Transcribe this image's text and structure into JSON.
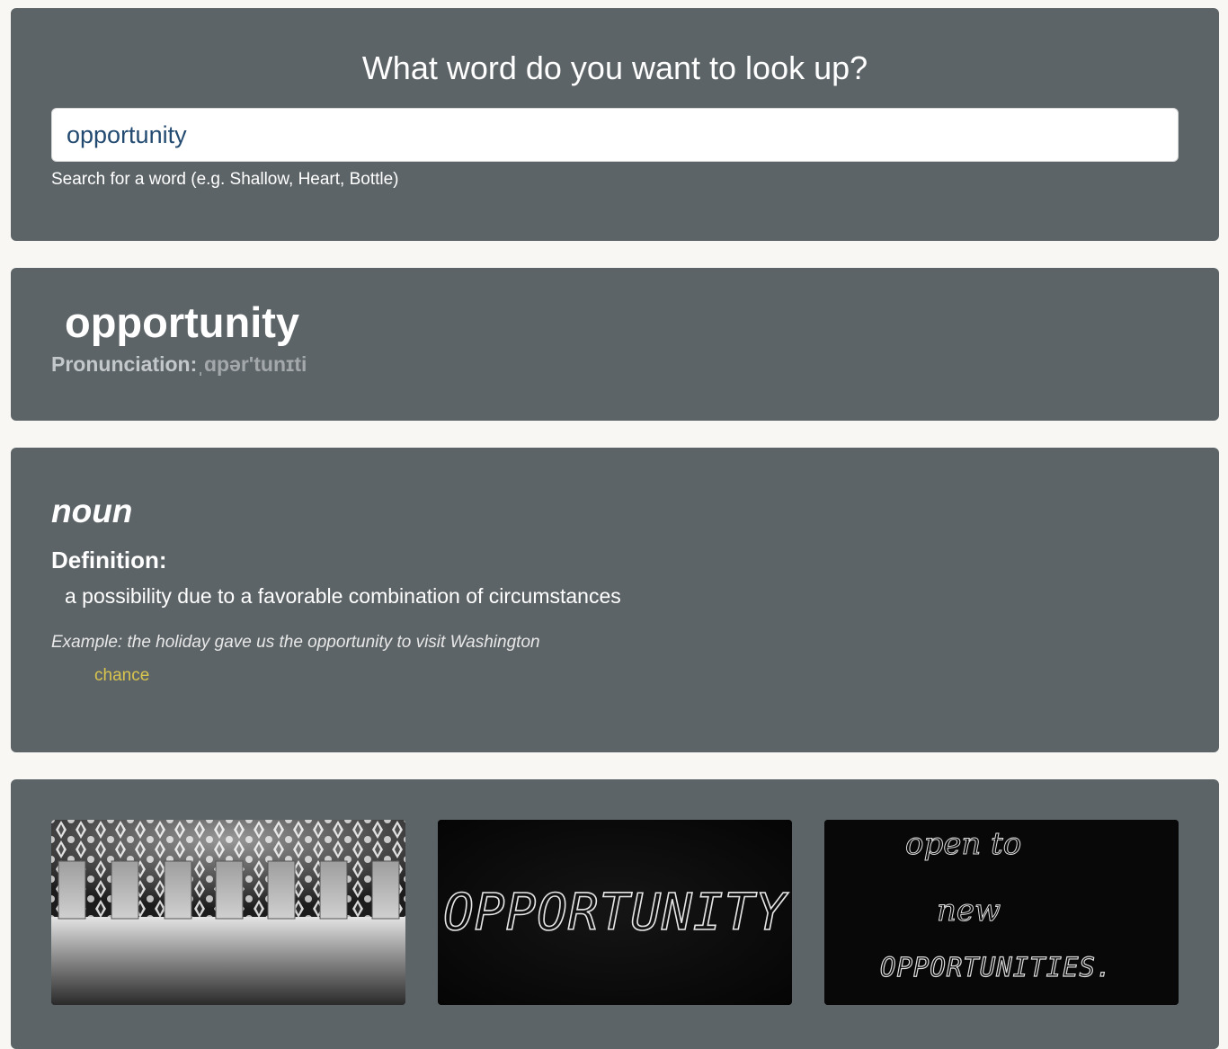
{
  "search": {
    "heading": "What word do you want to look up?",
    "value": "opportunity",
    "hint": "Search for a word (e.g. Shallow, Heart, Bottle)"
  },
  "word": {
    "title": "opportunity",
    "pronunciation_label": "Pronunciation:",
    "pronunciation_value": "ˌɑpər'tunɪti"
  },
  "meaning": {
    "part_of_speech": "noun",
    "definition_label": "Definition:",
    "definition": "a possibility due to a favorable combination of circumstances",
    "example": "Example: the holiday gave us the opportunity to visit Washington",
    "synonyms": [
      "chance"
    ]
  },
  "images": {
    "items": [
      {
        "icon": "doors-photo"
      },
      {
        "icon": "chalk-opportunity-photo",
        "text": "OPPORTUNITY"
      },
      {
        "icon": "chalk-open-to-new-photo",
        "lines": [
          "open to",
          "new",
          "OPPORTUNITIES."
        ]
      }
    ]
  },
  "colors": {
    "card_background": "#5d6467",
    "page_background": "#f8f7f3",
    "input_text": "#234a70",
    "synonym": "#d8c54e"
  }
}
